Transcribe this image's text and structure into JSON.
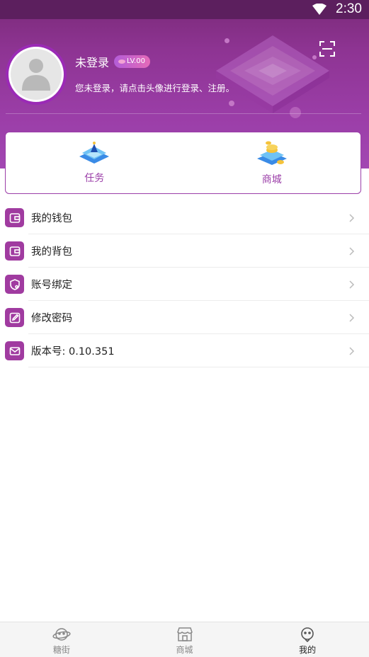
{
  "status": {
    "time": "2:30"
  },
  "profile": {
    "username": "未登录",
    "level": "LV.00",
    "hint": "您未登录，请点击头像进行登录、注册。"
  },
  "quick_actions": [
    {
      "label": "任务",
      "icon": "task-pyramid-icon"
    },
    {
      "label": "商城",
      "icon": "shop-coins-icon"
    }
  ],
  "menu": [
    {
      "label": "我的钱包",
      "icon": "wallet-icon"
    },
    {
      "label": "我的背包",
      "icon": "backpack-icon"
    },
    {
      "label": "账号绑定",
      "icon": "shield-icon"
    },
    {
      "label": "修改密码",
      "icon": "edit-icon"
    },
    {
      "label": "版本号: 0.10.351",
      "icon": "mail-icon"
    }
  ],
  "bottom_nav": [
    {
      "label": "糖街",
      "icon": "planet-face-icon",
      "active": false
    },
    {
      "label": "商城",
      "icon": "store-icon",
      "active": false
    },
    {
      "label": "我的",
      "icon": "smiley-icon",
      "active": true
    }
  ],
  "colors": {
    "accent": "#9b3ea8",
    "status_bar": "#5c1f5e"
  }
}
